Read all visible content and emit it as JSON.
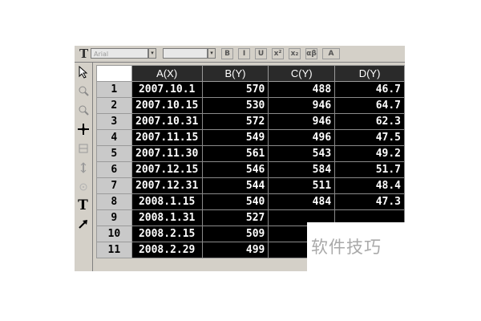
{
  "columns": [
    "A(X)",
    "B(Y)",
    "C(Y)",
    "D(Y)"
  ],
  "rows": [
    {
      "n": "1",
      "a": "2007.10.1",
      "b": "570",
      "c": "488",
      "d": "46.7"
    },
    {
      "n": "2",
      "a": "2007.10.15",
      "b": "530",
      "c": "946",
      "d": "64.7"
    },
    {
      "n": "3",
      "a": "2007.10.31",
      "b": "572",
      "c": "946",
      "d": "62.3"
    },
    {
      "n": "4",
      "a": "2007.11.15",
      "b": "549",
      "c": "496",
      "d": "47.5"
    },
    {
      "n": "5",
      "a": "2007.11.30",
      "b": "561",
      "c": "543",
      "d": "49.2"
    },
    {
      "n": "6",
      "a": "2007.12.15",
      "b": "546",
      "c": "584",
      "d": "51.7"
    },
    {
      "n": "7",
      "a": "2007.12.31",
      "b": "544",
      "c": "511",
      "d": "48.4"
    },
    {
      "n": "8",
      "a": "2008.1.15",
      "b": "540",
      "c": "484",
      "d": "47.3"
    },
    {
      "n": "9",
      "a": "2008.1.31",
      "b": "527",
      "c": "",
      "d": ""
    },
    {
      "n": "10",
      "a": "2008.2.15",
      "b": "509",
      "c": "",
      "d": ""
    },
    {
      "n": "11",
      "a": "2008.2.29",
      "b": "499",
      "c": "",
      "d": ""
    }
  ],
  "toolbar": {
    "font_name": "Arial",
    "dropdown_arrow": "▾",
    "text_tool_glyph": "T",
    "buttons": [
      "B",
      "I",
      "U",
      "x²",
      "x₂",
      "αβ",
      "A"
    ]
  },
  "palette": {
    "tools": [
      "pointer-icon",
      "zoom-in-icon",
      "zoom-out-icon",
      "crosshair-icon",
      "screen-reader-icon",
      "data-reader-icon",
      "data-selector-icon",
      "text-tool-icon",
      "arrow-tool-icon"
    ],
    "text_tool_glyph": "T"
  },
  "watermark": "软件技巧"
}
